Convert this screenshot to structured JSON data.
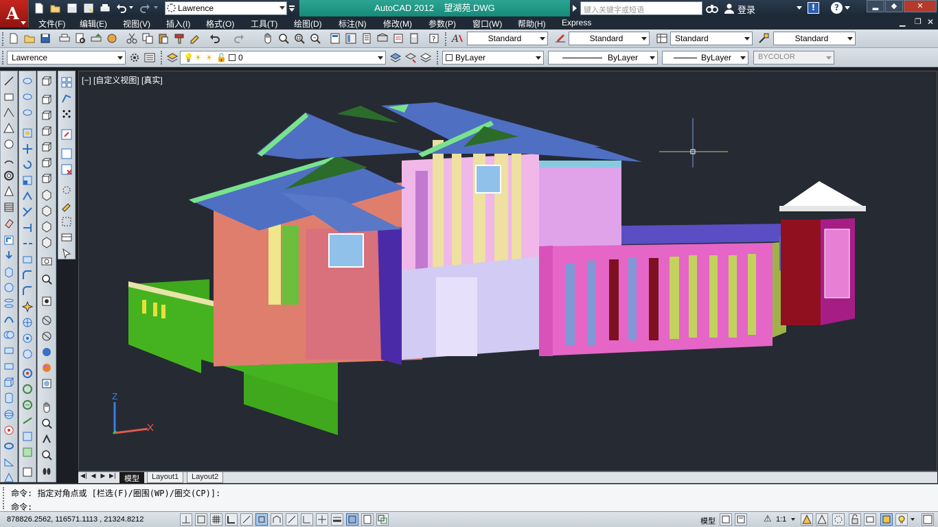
{
  "title_bar": {
    "app_name": "AutoCAD 2012",
    "document": "望湖苑.DWG",
    "workspace": "Lawrence",
    "search_placeholder": "键入关键字或短语",
    "sign_in": "登录"
  },
  "menu": {
    "items": [
      "文件(F)",
      "编辑(E)",
      "视图(V)",
      "插入(I)",
      "格式(O)",
      "工具(T)",
      "绘图(D)",
      "标注(N)",
      "修改(M)",
      "参数(P)",
      "窗口(W)",
      "帮助(H)",
      "Express"
    ]
  },
  "styles_toolbar": {
    "text_style": "Standard",
    "dim_style": "Standard",
    "table_style": "Standard",
    "mleader_style": "Standard"
  },
  "layers_toolbar": {
    "workspace": "Lawrence",
    "layer": "0",
    "color": "ByLayer",
    "linetype": "ByLayer",
    "lineweight": "ByLayer",
    "plotstyle": "BYCOLOR"
  },
  "viewport": {
    "label": "[−] [自定义视图] [真实]",
    "ucs_axis": "Z"
  },
  "tabs": [
    "模型",
    "Layout1",
    "Layout2"
  ],
  "command": {
    "history": "命令: 指定对角点或 [栏选(F)/圈围(WP)/圈交(CP)]:",
    "prompt": "命令:"
  },
  "status": {
    "coordinates": "878826.2562,  116571.1113 ,  21324.8212",
    "space": "模型",
    "annotation_scale": "1:1"
  },
  "colors": {
    "title_accent": "#1a9583",
    "viewport_bg": "#262a33",
    "logo_red": "#c4251f"
  }
}
